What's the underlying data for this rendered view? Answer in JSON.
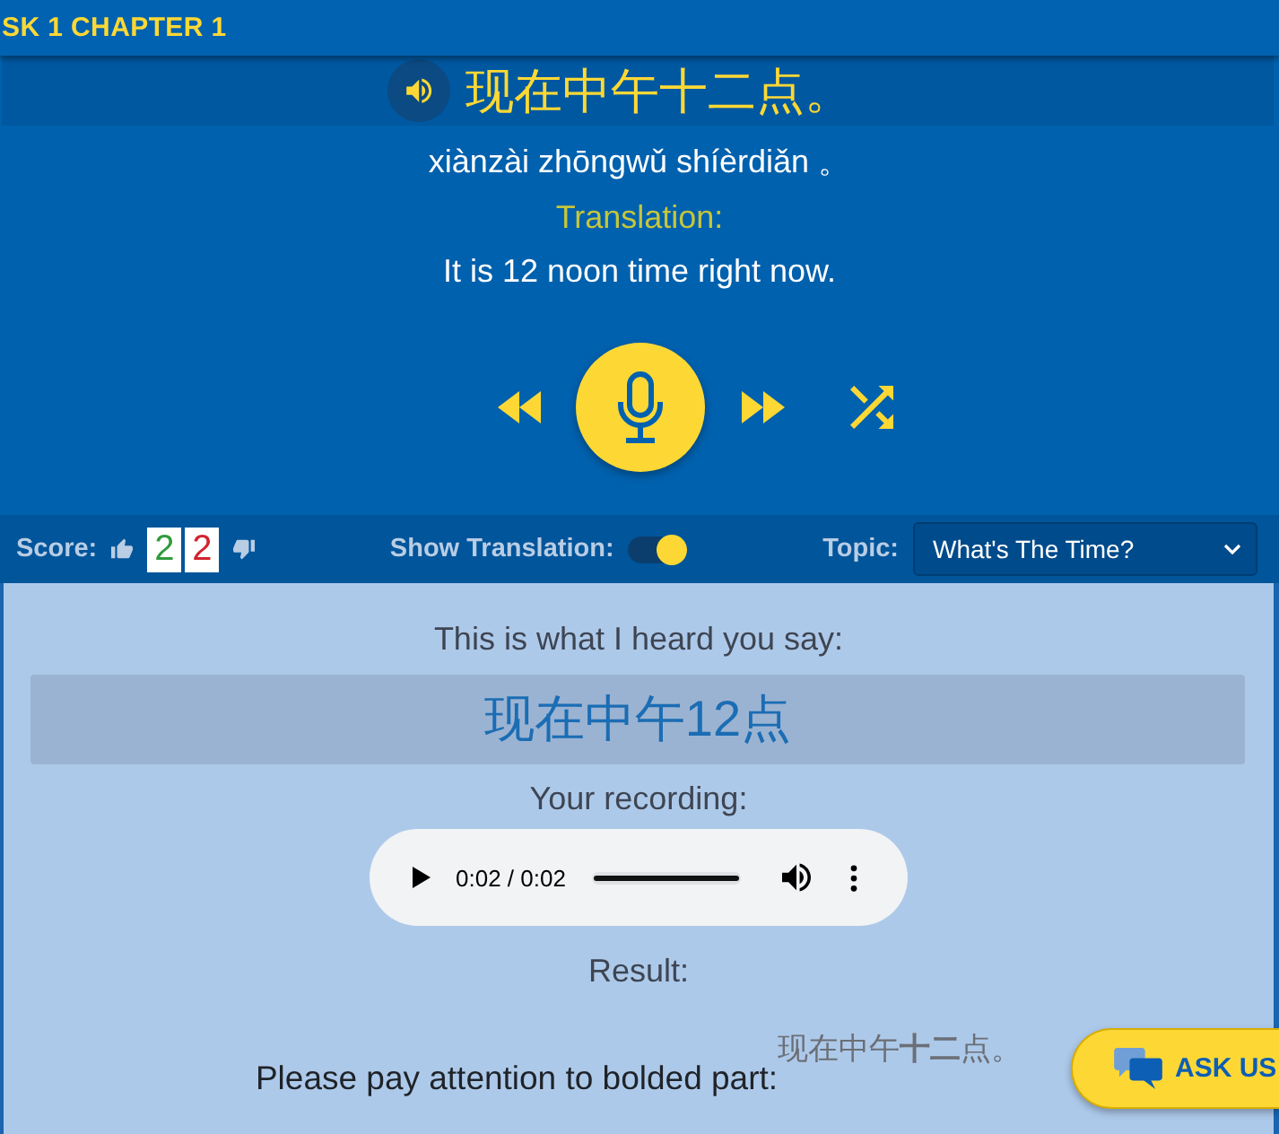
{
  "header": {
    "title": "SK 1 CHAPTER 1"
  },
  "sentence": {
    "hanzi": "现在中午十二点。",
    "pinyin": "xiànzài zhōngwǔ shíèrdiǎn 。",
    "translation_label": "Translation:",
    "translation": "It is 12 noon time right now."
  },
  "score_bar": {
    "score_label": "Score:",
    "correct": "2",
    "wrong": "2",
    "show_translation_label": "Show Translation:",
    "show_translation_on": true,
    "topic_label": "Topic:",
    "topic": "What's The Time?"
  },
  "result_panel": {
    "heard_label": "This is what I heard you say:",
    "heard_text": "现在中午12点",
    "recording_label": "Your recording:",
    "player": {
      "time": "0:02 / 0:02",
      "level": 1
    },
    "result_label": "Result:",
    "attention_label": "Please pay attention to bolded part:",
    "marked_sentence": "现在中午**十二**点。"
  },
  "ask_button": {
    "label": "ASK US"
  }
}
